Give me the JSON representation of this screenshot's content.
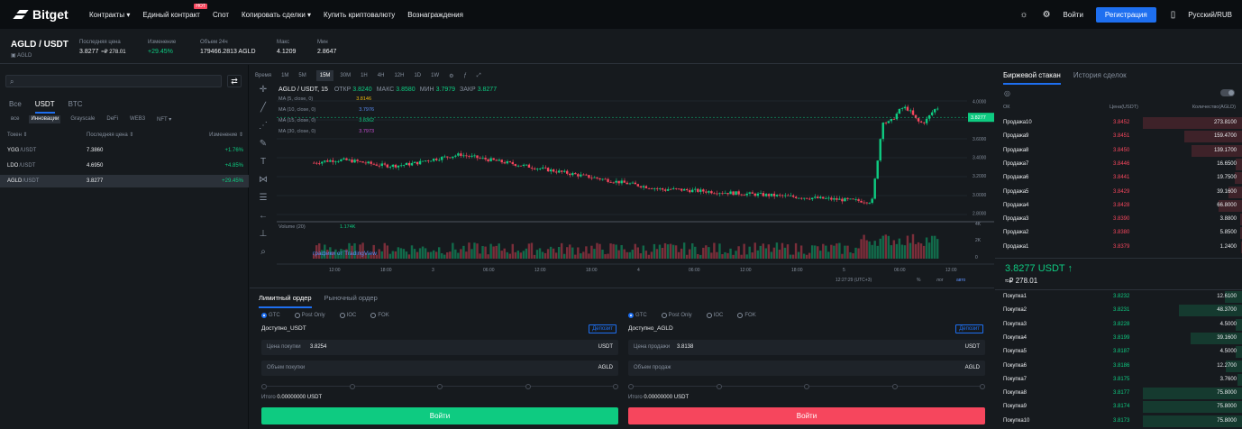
{
  "header": {
    "brand": "Bitget",
    "nav": [
      {
        "label": "Контракты",
        "dropdown": true
      },
      {
        "label": "Единый контракт",
        "badge": "HOT"
      },
      {
        "label": "Спот"
      },
      {
        "label": "Копировать сделки",
        "dropdown": true
      },
      {
        "label": "Купить криптовалюту"
      },
      {
        "label": "Вознаграждения"
      }
    ],
    "login": "Войти",
    "register": "Регистрация",
    "language": "Русский/RUB",
    "icons": [
      "sun-icon",
      "gear-icon",
      "phone-icon"
    ]
  },
  "ticker": {
    "pair": "AGLD / USDT",
    "sub": "AGLD",
    "stats": [
      {
        "label": "Последняя цена",
        "value": "3.8277",
        "extra": "≈₽ 278.01",
        "cls": ""
      },
      {
        "label": "Изменение",
        "value": "+29.45%",
        "cls": "green"
      },
      {
        "label": "Объем 24ч",
        "value": "179466.2813 AGLD",
        "cls": ""
      },
      {
        "label": "Макс",
        "value": "4.1209",
        "cls": ""
      },
      {
        "label": "Мин",
        "value": "2.8647",
        "cls": ""
      }
    ]
  },
  "markets": {
    "search_placeholder": "",
    "tabs": [
      "Все",
      "USDT",
      "BTC"
    ],
    "active_tab": 1,
    "subtabs": [
      "все",
      "Инновации",
      "Grayscale",
      "DeFi",
      "WEB3",
      "NFT ▾"
    ],
    "active_subtab": 1,
    "headers": [
      "Токен ⇕",
      "Последняя цена ⇕",
      "Изменение ⇕"
    ],
    "rows": [
      {
        "base": "YGG",
        "quote": "/USDT",
        "price": "7.3860",
        "change": "+1.76%",
        "selected": false
      },
      {
        "base": "LDO",
        "quote": "/USDT",
        "price": "4.6950",
        "change": "+4.85%",
        "selected": false
      },
      {
        "base": "AGLD",
        "quote": "/USDT",
        "price": "3.8277",
        "change": "+29.45%",
        "selected": true
      }
    ]
  },
  "chart": {
    "intervals": [
      "Время",
      "1M",
      "5M",
      "15M",
      "30M",
      "1H",
      "4H",
      "12H",
      "1D",
      "1W"
    ],
    "active_interval": 3,
    "symbol": "AGLD / USDT, 15",
    "ohlc": [
      {
        "k": "ОТКР",
        "v": "3.8240"
      },
      {
        "k": "МАКС",
        "v": "3.8580"
      },
      {
        "k": "МИН",
        "v": "3.7979"
      },
      {
        "k": "ЗАКР",
        "v": "3.8277"
      }
    ],
    "ma": [
      {
        "label": "MA (5, close, 0)",
        "value": "3.8146",
        "color": "#f0b90b"
      },
      {
        "label": "MA (10, close, 0)",
        "value": "3.7976",
        "color": "#5b8ff9"
      },
      {
        "label": "MA (15, close, 0)",
        "value": "3.8362",
        "color": "#0ecb81"
      },
      {
        "label": "MA (30, close, 0)",
        "value": "3.7973",
        "color": "#c94fd6"
      }
    ],
    "y_ticks": [
      "4.0000",
      "3.8000",
      "3.6000",
      "3.4000",
      "3.2000",
      "3.0000",
      "2.8000"
    ],
    "last_price": "3.8277",
    "volume_label": "Volume (20)",
    "volume_value": "1.174K",
    "vol_ticks": [
      "4K",
      "2K",
      "0"
    ],
    "x_ticks": [
      "12:00",
      "18:00",
      "3",
      "06:00",
      "12:00",
      "18:00",
      "4",
      "06:00",
      "12:00",
      "18:00",
      "5",
      "06:00",
      "12:00"
    ],
    "time": "12:27:29 (UTC+3)",
    "scale_opts": [
      "%",
      "лог",
      "авто"
    ],
    "tv_label": "графики от TradingView"
  },
  "order": {
    "tabs": [
      "Лимитный ордер",
      "Рыночный ордер"
    ],
    "tif": [
      "GTC",
      "Post Only",
      "IOC",
      "FOK"
    ],
    "deposit": "Депозит",
    "buy": {
      "avail": "Доступно_USDT",
      "price_label": "Цена покупки",
      "price": "3.8254",
      "price_unit": "USDT",
      "amount_label": "Объем покупки",
      "amount_unit": "AGLD",
      "total_label": "Итого",
      "total": "0.00000000 USDT",
      "button": "Войти"
    },
    "sell": {
      "avail": "Доступно_AGLD",
      "price_label": "Цена продажи",
      "price": "3.8138",
      "price_unit": "USDT",
      "amount_label": "Объем продаж",
      "amount_unit": "AGLD",
      "total_label": "Итого",
      "total": "0.00000000 USDT",
      "button": "Войти"
    }
  },
  "book": {
    "tabs": [
      "Биржевой стакан",
      "История сделок"
    ],
    "headers": [
      "ОК",
      "Цена(USDT)",
      "Количество(AGLD)"
    ],
    "asks": [
      {
        "label": "Продажа10",
        "price": "3.8452",
        "qty": "273.8100",
        "depth": 1.0
      },
      {
        "label": "Продажа9",
        "price": "3.8451",
        "qty": "159.4700",
        "depth": 0.58
      },
      {
        "label": "Продажа8",
        "price": "3.8450",
        "qty": "139.1700",
        "depth": 0.51
      },
      {
        "label": "Продажа7",
        "price": "3.8446",
        "qty": "16.6500",
        "depth": 0.06
      },
      {
        "label": "Продажа6",
        "price": "3.8441",
        "qty": "19.7500",
        "depth": 0.07
      },
      {
        "label": "Продажа5",
        "price": "3.8429",
        "qty": "39.1600",
        "depth": 0.14
      },
      {
        "label": "Продажа4",
        "price": "3.8428",
        "qty": "66.8000",
        "depth": 0.24
      },
      {
        "label": "Продажа3",
        "price": "3.8390",
        "qty": "3.8800",
        "depth": 0.02
      },
      {
        "label": "Продажа2",
        "price": "3.8380",
        "qty": "5.8500",
        "depth": 0.02
      },
      {
        "label": "Продажа1",
        "price": "3.8379",
        "qty": "1.2400",
        "depth": 0.01
      }
    ],
    "last": "3.8277 USDT ↑",
    "last_fiat": "≈₽ 278.01",
    "bids": [
      {
        "label": "Покупка1",
        "price": "3.8232",
        "qty": "12.6100",
        "depth": 0.17
      },
      {
        "label": "Покупка2",
        "price": "3.8231",
        "qty": "48.3700",
        "depth": 0.64
      },
      {
        "label": "Покупка3",
        "price": "3.8228",
        "qty": "4.5000",
        "depth": 0.06
      },
      {
        "label": "Покупка4",
        "price": "3.8199",
        "qty": "39.1600",
        "depth": 0.52
      },
      {
        "label": "Покупка5",
        "price": "3.8187",
        "qty": "4.5000",
        "depth": 0.06
      },
      {
        "label": "Покупка6",
        "price": "3.8186",
        "qty": "12.2700",
        "depth": 0.16
      },
      {
        "label": "Покупка7",
        "price": "3.8175",
        "qty": "3.7600",
        "depth": 0.05
      },
      {
        "label": "Покупка8",
        "price": "3.8177",
        "qty": "75.8000",
        "depth": 1.0
      },
      {
        "label": "Покупка9",
        "price": "3.8174",
        "qty": "75.8000",
        "depth": 1.0
      },
      {
        "label": "Покупка10",
        "price": "3.8173",
        "qty": "75.8000",
        "depth": 1.0
      }
    ]
  },
  "colors": {
    "up": "#0ecb81",
    "down": "#f6465d",
    "accent": "#1e6ff0"
  }
}
